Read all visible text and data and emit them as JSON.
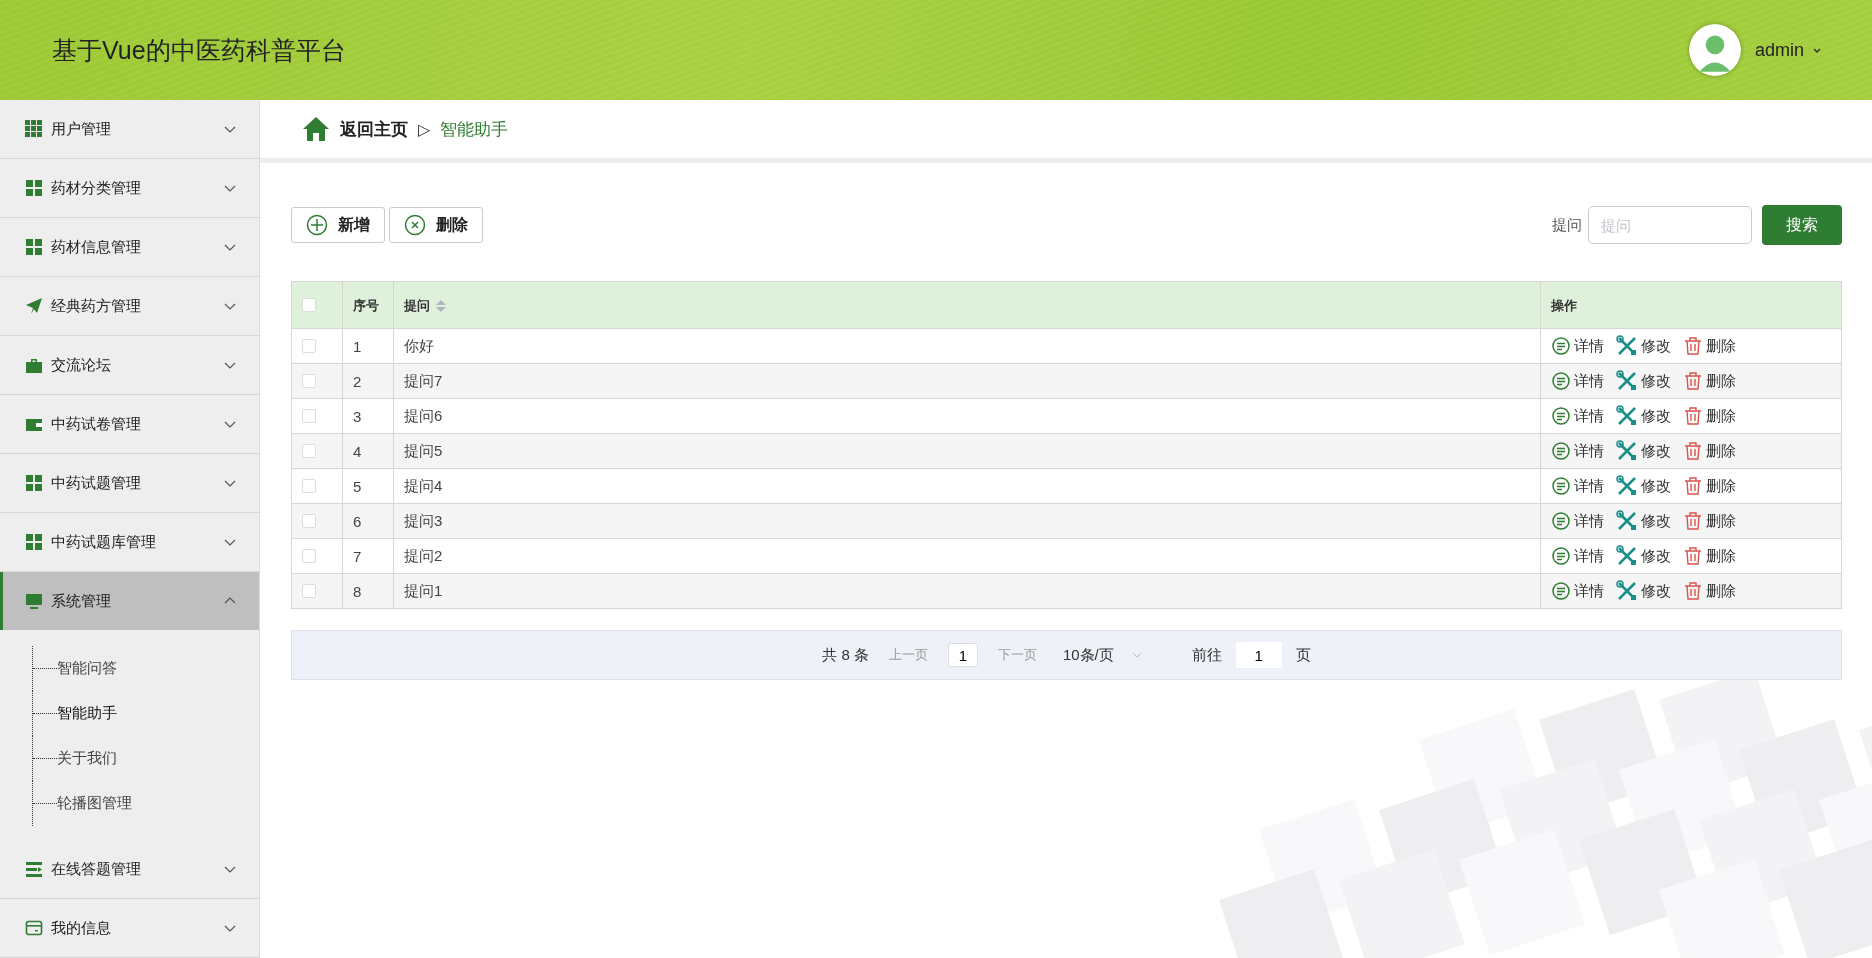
{
  "header": {
    "title": "基于Vue的中医药科普平台",
    "user": {
      "name": "admin"
    }
  },
  "sidebar": {
    "items": [
      {
        "label": "用户管理",
        "kind": "grid9",
        "expanded": false
      },
      {
        "label": "药材分类管理",
        "kind": "grid4",
        "expanded": false
      },
      {
        "label": "药材信息管理",
        "kind": "grid4",
        "expanded": false
      },
      {
        "label": "经典药方管理",
        "kind": "plane",
        "expanded": false
      },
      {
        "label": "交流论坛",
        "kind": "briefcase",
        "expanded": false
      },
      {
        "label": "中药试卷管理",
        "kind": "wallet",
        "expanded": false
      },
      {
        "label": "中药试题管理",
        "kind": "grid4",
        "expanded": false
      },
      {
        "label": "中药试题库管理",
        "kind": "grid4",
        "expanded": false
      },
      {
        "label": "系统管理",
        "kind": "monitor",
        "expanded": true,
        "children": [
          {
            "label": "智能问答",
            "selected": false
          },
          {
            "label": "智能助手",
            "selected": true
          },
          {
            "label": "关于我们",
            "selected": false
          },
          {
            "label": "轮播图管理",
            "selected": false
          }
        ]
      },
      {
        "label": "在线答题管理",
        "kind": "list",
        "expanded": false
      },
      {
        "label": "我的信息",
        "kind": "card",
        "expanded": false
      }
    ]
  },
  "breadcrumb": {
    "home": "返回主页",
    "separator": "▷",
    "current": "智能助手"
  },
  "toolbar": {
    "buttons": [
      {
        "label": "新增",
        "kind": "add"
      },
      {
        "label": "删除",
        "kind": "remove"
      }
    ],
    "search": {
      "label": "提问",
      "placeholder": "提问",
      "button": "搜索"
    }
  },
  "table": {
    "header_checked": false,
    "columns": [
      {
        "label": "序号",
        "sortable": false
      },
      {
        "label": "提问",
        "sortable": true
      },
      {
        "label": "操作",
        "sortable": false
      }
    ],
    "rows": [
      {
        "index": "1",
        "question": "你好",
        "checked": false,
        "actions": [
          {
            "label": "详情",
            "kind": "detail"
          },
          {
            "label": "修改",
            "kind": "edit"
          },
          {
            "label": "删除",
            "kind": "delete"
          }
        ]
      },
      {
        "index": "2",
        "question": "提问7",
        "checked": false,
        "actions": [
          {
            "label": "详情",
            "kind": "detail"
          },
          {
            "label": "修改",
            "kind": "edit"
          },
          {
            "label": "删除",
            "kind": "delete"
          }
        ]
      },
      {
        "index": "3",
        "question": "提问6",
        "checked": false,
        "actions": [
          {
            "label": "详情",
            "kind": "detail"
          },
          {
            "label": "修改",
            "kind": "edit"
          },
          {
            "label": "删除",
            "kind": "delete"
          }
        ]
      },
      {
        "index": "4",
        "question": "提问5",
        "checked": false,
        "actions": [
          {
            "label": "详情",
            "kind": "detail"
          },
          {
            "label": "修改",
            "kind": "edit"
          },
          {
            "label": "删除",
            "kind": "delete"
          }
        ]
      },
      {
        "index": "5",
        "question": "提问4",
        "checked": false,
        "actions": [
          {
            "label": "详情",
            "kind": "detail"
          },
          {
            "label": "修改",
            "kind": "edit"
          },
          {
            "label": "删除",
            "kind": "delete"
          }
        ]
      },
      {
        "index": "6",
        "question": "提问3",
        "checked": false,
        "actions": [
          {
            "label": "详情",
            "kind": "detail"
          },
          {
            "label": "修改",
            "kind": "edit"
          },
          {
            "label": "删除",
            "kind": "delete"
          }
        ]
      },
      {
        "index": "7",
        "question": "提问2",
        "checked": false,
        "actions": [
          {
            "label": "详情",
            "kind": "detail"
          },
          {
            "label": "修改",
            "kind": "edit"
          },
          {
            "label": "删除",
            "kind": "delete"
          }
        ]
      },
      {
        "index": "8",
        "question": "提问1",
        "checked": false,
        "actions": [
          {
            "label": "详情",
            "kind": "detail"
          },
          {
            "label": "修改",
            "kind": "edit"
          },
          {
            "label": "删除",
            "kind": "delete"
          }
        ]
      }
    ]
  },
  "pagination": {
    "total": "共 8 条",
    "prev": "上一页",
    "page": "1",
    "next": "下一页",
    "page_size": "10条/页",
    "goto_label": "前往",
    "goto_value": "1",
    "goto_suffix": "页"
  }
}
